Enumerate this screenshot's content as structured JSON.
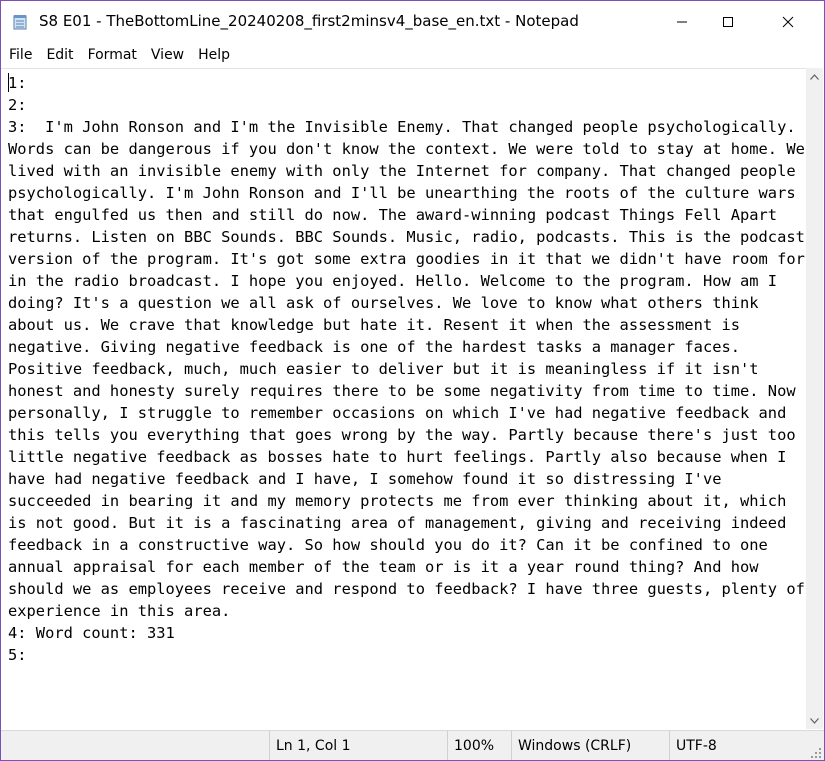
{
  "window": {
    "title": "S8 E01 - TheBottomLine_20240208_first2minsv4_base_en.txt - Notepad",
    "app_icon": "notepad-icon",
    "controls": {
      "minimize_icon": "minimize-icon",
      "maximize_icon": "maximize-icon",
      "close_icon": "close-icon"
    }
  },
  "menu": {
    "items": [
      "File",
      "Edit",
      "Format",
      "View",
      "Help"
    ]
  },
  "editor": {
    "content": "1:\n2:\n3:  I'm John Ronson and I'm the Invisible Enemy. That changed people psychologically. Words can be dangerous if you don't know the context. We were told to stay at home. We lived with an invisible enemy with only the Internet for company. That changed people psychologically. I'm John Ronson and I'll be unearthing the roots of the culture wars that engulfed us then and still do now. The award-winning podcast Things Fell Apart returns. Listen on BBC Sounds. BBC Sounds. Music, radio, podcasts. This is the podcast version of the program. It's got some extra goodies in it that we didn't have room for in the radio broadcast. I hope you enjoyed. Hello. Welcome to the program. How am I doing? It's a question we all ask of ourselves. We love to know what others think about us. We crave that knowledge but hate it. Resent it when the assessment is negative. Giving negative feedback is one of the hardest tasks a manager faces. Positive feedback, much, much easier to deliver but it is meaningless if it isn't honest and honesty surely requires there to be some negativity from time to time. Now personally, I struggle to remember occasions on which I've had negative feedback and this tells you everything that goes wrong by the way. Partly because there's just too little negative feedback as bosses hate to hurt feelings. Partly also because when I have had negative feedback and I have, I somehow found it so distressing I've succeeded in bearing it and my memory protects me from ever thinking about it, which is not good. But it is a fascinating area of management, giving and receiving indeed feedback in a constructive way. So how should you do it? Can it be confined to one annual appraisal for each member of the team or is it a year round thing? And how should we as employees receive and respond to feedback? I have three guests, plenty of experience in this area.\n4: Word count: 331\n5:"
  },
  "status": {
    "position": "Ln 1, Col 1",
    "zoom": "100%",
    "line_ending": "Windows (CRLF)",
    "encoding": "UTF-8"
  },
  "colors": {
    "window_border": "#7a4fb8",
    "statusbar_bg": "#f0f0f0",
    "scrollbar_bg": "#f0f0f0"
  }
}
